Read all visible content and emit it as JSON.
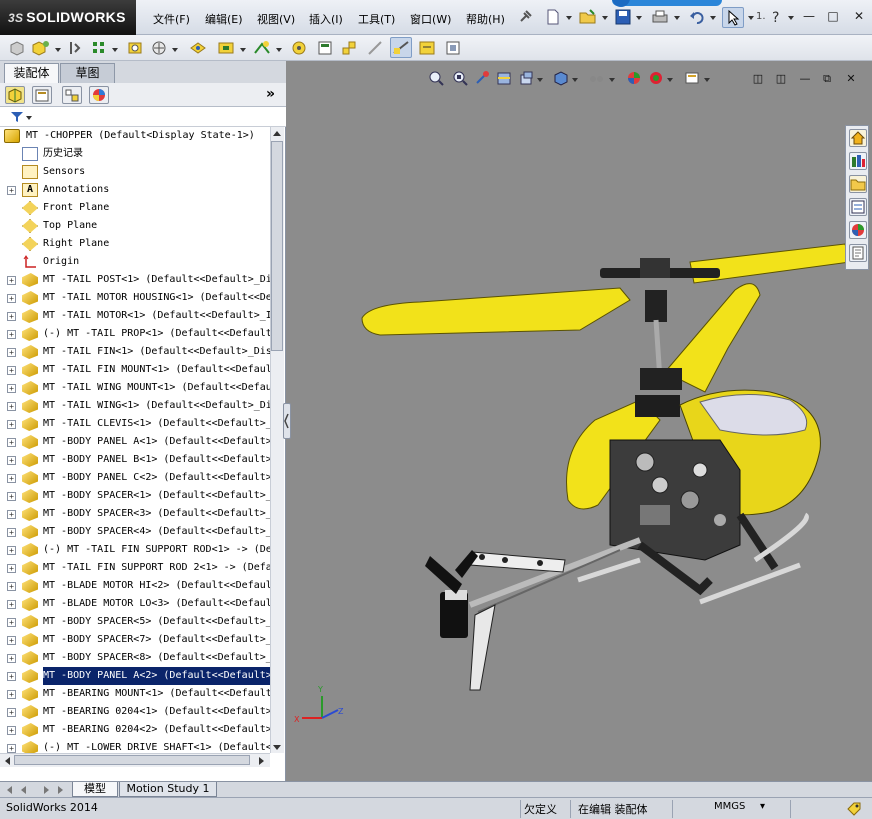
{
  "app": {
    "brand": "SOLIDWORKS",
    "brand_prefix": "3S",
    "version_label": "SolidWorks 2014"
  },
  "menu": [
    "文件(F)",
    "编辑(E)",
    "视图(V)",
    "插入(I)",
    "工具(T)",
    "窗口(W)",
    "帮助(H)"
  ],
  "panel_tabs": [
    "装配体",
    "草图"
  ],
  "panel": {
    "collapse_glyph": "»"
  },
  "tree": {
    "root": "MT -CHOPPER  (Default<Display State-1>)",
    "items": [
      {
        "label": "历史记录",
        "icon": "history-icon",
        "expand": false
      },
      {
        "label": "Sensors",
        "icon": "sensors-icon",
        "expand": false
      },
      {
        "label": "Annotations",
        "icon": "annotations-icon",
        "expand": true
      },
      {
        "label": "Front Plane",
        "icon": "plane-icon",
        "expand": false
      },
      {
        "label": "Top Plane",
        "icon": "plane-icon",
        "expand": false
      },
      {
        "label": "Right Plane",
        "icon": "plane-icon",
        "expand": false
      },
      {
        "label": "Origin",
        "icon": "origin-icon",
        "expand": false
      },
      {
        "label": "MT -TAIL POST<1> (Default<<Default>_Di",
        "icon": "part-icon",
        "expand": true
      },
      {
        "label": "MT -TAIL MOTOR HOUSING<1> (Default<<De",
        "icon": "part-icon",
        "expand": true
      },
      {
        "label": "MT -TAIL MOTOR<1> (Default<<Default>_I",
        "icon": "part-icon",
        "expand": true
      },
      {
        "label": "(-) MT -TAIL PROP<1> (Default<<Default",
        "icon": "part-icon",
        "expand": true
      },
      {
        "label": "MT -TAIL FIN<1> (Default<<Default>_Dis",
        "icon": "part-icon",
        "expand": true
      },
      {
        "label": "MT -TAIL FIN MOUNT<1> (Default<<Defaul",
        "icon": "part-icon",
        "expand": true
      },
      {
        "label": "MT -TAIL WING MOUNT<1> (Default<<Defau",
        "icon": "part-icon",
        "expand": true
      },
      {
        "label": "MT -TAIL WING<1> (Default<<Default>_Di",
        "icon": "part-icon",
        "expand": true
      },
      {
        "label": "MT -TAIL CLEVIS<1> (Default<<Default>_",
        "icon": "part-icon",
        "expand": true
      },
      {
        "label": "MT -BODY PANEL A<1> (Default<<Default>",
        "icon": "part-icon",
        "expand": true
      },
      {
        "label": "MT -BODY PANEL B<1> (Default<<Default>",
        "icon": "part-icon",
        "expand": true
      },
      {
        "label": "MT -BODY PANEL C<2> (Default<<Default>",
        "icon": "part-icon",
        "expand": true
      },
      {
        "label": "MT -BODY SPACER<1> (Default<<Default>_",
        "icon": "part-icon",
        "expand": true
      },
      {
        "label": "MT -BODY SPACER<3> (Default<<Default>_",
        "icon": "part-icon",
        "expand": true
      },
      {
        "label": "MT -BODY SPACER<4> (Default<<Default>_",
        "icon": "part-icon",
        "expand": true
      },
      {
        "label": "(-) MT -TAIL FIN SUPPORT ROD<1> -> (De",
        "icon": "part-icon",
        "expand": true
      },
      {
        "label": "MT -TAIL FIN SUPPORT ROD 2<1> -> (Defa",
        "icon": "part-icon",
        "expand": true
      },
      {
        "label": "MT -BLADE MOTOR HI<2> (Default<<Defaul",
        "icon": "part-icon",
        "expand": true
      },
      {
        "label": "MT -BLADE MOTOR LO<3> (Default<<Defaul",
        "icon": "part-icon",
        "expand": true
      },
      {
        "label": "MT -BODY SPACER<5> (Default<<Default>_",
        "icon": "part-icon",
        "expand": true
      },
      {
        "label": "MT -BODY SPACER<7> (Default<<Default>_",
        "icon": "part-icon",
        "expand": true
      },
      {
        "label": "MT -BODY SPACER<8> (Default<<Default>_",
        "icon": "part-icon",
        "expand": true
      },
      {
        "label": "MT -BODY PANEL A<2> (Default<<Default>",
        "icon": "part-icon",
        "expand": true,
        "selected": true
      },
      {
        "label": "MT -BEARING MOUNT<1> (Default<<Default",
        "icon": "part-icon",
        "expand": true
      },
      {
        "label": "MT -BEARING 0204<1> (Default<<Default>",
        "icon": "part-icon",
        "expand": true
      },
      {
        "label": "MT -BEARING 0204<2> (Default<<Default>",
        "icon": "part-icon",
        "expand": true
      },
      {
        "label": "(-) MT -LOWER DRIVE SHAFT<1> (Default<",
        "icon": "part-icon",
        "expand": true
      }
    ]
  },
  "bottom_tabs": [
    "模型",
    "Motion Study 1"
  ],
  "status": {
    "app": "SolidWorks 2014",
    "underdefined": "欠定义",
    "editing": "在编辑 装配体",
    "units": "MMGS",
    "units_arrow": "▾"
  },
  "triad": {
    "x": "X",
    "y": "Y",
    "z": "Z"
  },
  "colors": {
    "blade_yellow": "#f2e21a",
    "canopy_yellow": "#e8d61a",
    "viewport_bg": "#8c8c8c",
    "selection": "#0a246a"
  }
}
